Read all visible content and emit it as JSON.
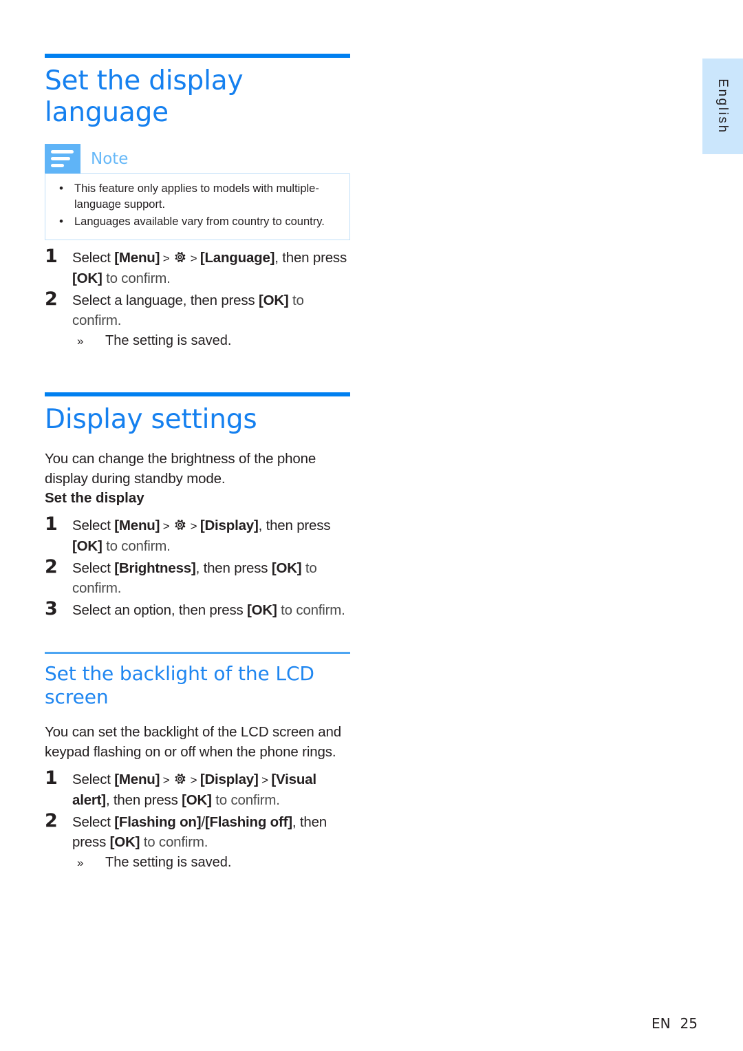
{
  "side_tab": {
    "label": "English"
  },
  "footer": {
    "lang_code": "EN",
    "page_number": "25"
  },
  "sections": [
    {
      "id": "set-display-language",
      "title": "Set the display language",
      "note": {
        "label": "Note",
        "items": [
          "This feature only applies to models with multiple-language support.",
          "Languages available vary from country to country."
        ]
      },
      "steps": [
        {
          "number": "1",
          "parts": [
            {
              "t": "Select ",
              "style": "plain"
            },
            {
              "t": "[Menu]",
              "style": "bold"
            },
            {
              "t": " > ",
              "style": "gt"
            },
            {
              "t": "gear-icon",
              "style": "icon"
            },
            {
              "t": " > ",
              "style": "gt"
            },
            {
              "t": "[Language]",
              "style": "bold"
            },
            {
              "t": ", then press ",
              "style": "plain"
            },
            {
              "t": "[OK]",
              "style": "bold"
            },
            {
              "t": " to confirm.",
              "style": "dim"
            }
          ]
        },
        {
          "number": "2",
          "parts": [
            {
              "t": "Select a language, then press ",
              "style": "plain"
            },
            {
              "t": "[OK]",
              "style": "bold"
            },
            {
              "t": " to confirm.",
              "style": "dim"
            }
          ],
          "result": "The setting is saved."
        }
      ]
    },
    {
      "id": "display-settings",
      "title": "Display settings",
      "intro": "You can change the brightness of the phone display during standby mode.",
      "subheading": "Set the display",
      "steps": [
        {
          "number": "1",
          "parts": [
            {
              "t": "Select ",
              "style": "plain"
            },
            {
              "t": "[Menu]",
              "style": "bold"
            },
            {
              "t": " > ",
              "style": "gt"
            },
            {
              "t": "gear-icon",
              "style": "icon"
            },
            {
              "t": " > ",
              "style": "gt"
            },
            {
              "t": "[Display]",
              "style": "bold"
            },
            {
              "t": ", then press ",
              "style": "plain"
            },
            {
              "t": "[OK]",
              "style": "bold"
            },
            {
              "t": " to confirm.",
              "style": "dim"
            }
          ]
        },
        {
          "number": "2",
          "parts": [
            {
              "t": "Select ",
              "style": "plain"
            },
            {
              "t": "[Brightness]",
              "style": "bold"
            },
            {
              "t": ", then press ",
              "style": "plain"
            },
            {
              "t": "[OK]",
              "style": "bold"
            },
            {
              "t": " to confirm.",
              "style": "dim"
            }
          ]
        },
        {
          "number": "3",
          "parts": [
            {
              "t": "Select an option, then press ",
              "style": "plain"
            },
            {
              "t": "[OK]",
              "style": "bold"
            },
            {
              "t": " to confirm.",
              "style": "dim"
            }
          ]
        }
      ]
    },
    {
      "id": "set-backlight-lcd",
      "title": "Set the backlight of the LCD screen",
      "intro": "You can set the backlight of the LCD screen and keypad flashing on or off when the phone rings.",
      "steps": [
        {
          "number": "1",
          "parts": [
            {
              "t": "Select ",
              "style": "plain"
            },
            {
              "t": "[Menu]",
              "style": "bold"
            },
            {
              "t": " > ",
              "style": "gt"
            },
            {
              "t": "gear-icon",
              "style": "icon"
            },
            {
              "t": " > ",
              "style": "gt"
            },
            {
              "t": "[Display]",
              "style": "bold"
            },
            {
              "t": " > ",
              "style": "gt"
            },
            {
              "t": "[Visual alert]",
              "style": "bold"
            },
            {
              "t": ", then press ",
              "style": "plain"
            },
            {
              "t": "[OK]",
              "style": "bold"
            },
            {
              "t": " to confirm.",
              "style": "dim"
            }
          ]
        },
        {
          "number": "2",
          "parts": [
            {
              "t": "Select ",
              "style": "plain"
            },
            {
              "t": "[Flashing on]",
              "style": "bold"
            },
            {
              "t": "/",
              "style": "plain"
            },
            {
              "t": "[Flashing off]",
              "style": "bold"
            },
            {
              "t": ", then press ",
              "style": "plain"
            },
            {
              "t": "[OK]",
              "style": "bold"
            },
            {
              "t": " to confirm.",
              "style": "dim"
            }
          ],
          "result": "The setting is saved."
        }
      ]
    }
  ],
  "colors": {
    "heading_blue": "#1580ef",
    "rule_blue": "#0080f0",
    "rule_blue_light": "#4da5f2",
    "note_icon_blue": "#5fb4f7",
    "note_border": "#bfdff8",
    "tab_blue": "#cbe6fc",
    "text": "#231f20"
  }
}
